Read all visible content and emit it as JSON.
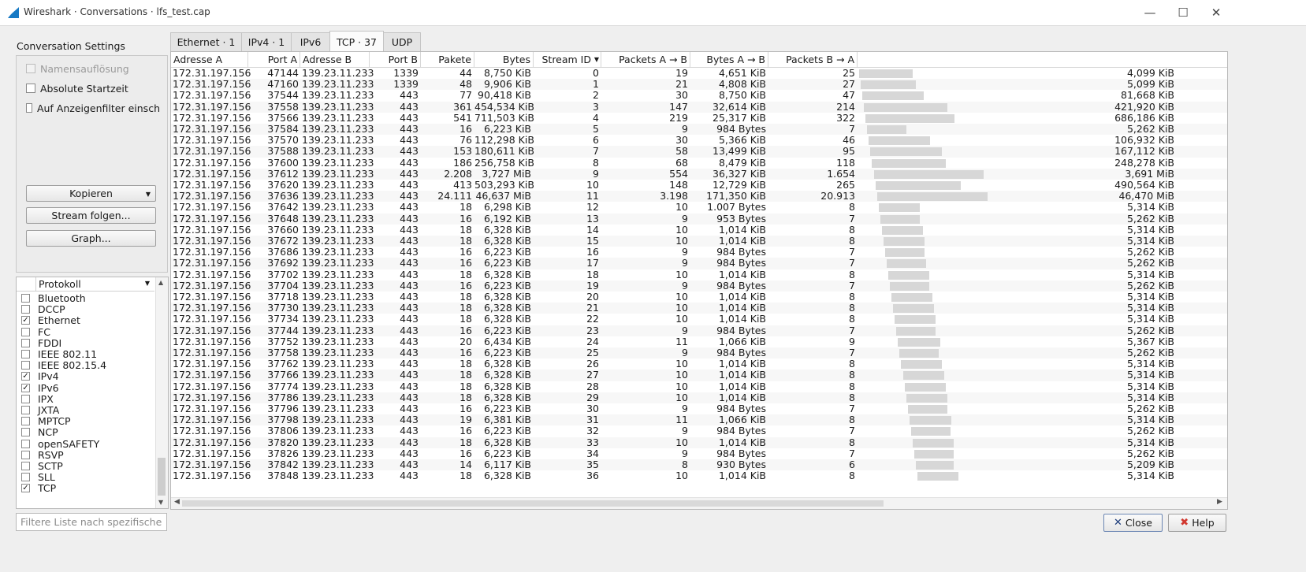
{
  "window": {
    "title": "Wireshark · Conversations · lfs_test.cap"
  },
  "settings": {
    "title": "Conversation Settings",
    "name_resolution": "Namensauflösung",
    "absolute_start": "Absolute Startzeit",
    "limit_filter": "Auf Anzeigenfilter einsch",
    "copy": "Kopieren",
    "follow_stream": "Stream folgen...",
    "graph": "Graph..."
  },
  "protocols": {
    "header": "Protokoll",
    "items": [
      {
        "label": "Bluetooth",
        "checked": false
      },
      {
        "label": "DCCP",
        "checked": false
      },
      {
        "label": "Ethernet",
        "checked": true
      },
      {
        "label": "FC",
        "checked": false
      },
      {
        "label": "FDDI",
        "checked": false
      },
      {
        "label": "IEEE 802.11",
        "checked": false
      },
      {
        "label": "IEEE 802.15.4",
        "checked": false
      },
      {
        "label": "IPv4",
        "checked": true
      },
      {
        "label": "IPv6",
        "checked": true
      },
      {
        "label": "IPX",
        "checked": false
      },
      {
        "label": "JXTA",
        "checked": false
      },
      {
        "label": "MPTCP",
        "checked": false
      },
      {
        "label": "NCP",
        "checked": false
      },
      {
        "label": "openSAFETY",
        "checked": false
      },
      {
        "label": "RSVP",
        "checked": false
      },
      {
        "label": "SCTP",
        "checked": false
      },
      {
        "label": "SLL",
        "checked": false
      },
      {
        "label": "TCP",
        "checked": true
      }
    ],
    "filter_placeholder": "Filtere Liste nach spezifische..."
  },
  "tabs": [
    "Ethernet · 1",
    "IPv4 · 1",
    "IPv6",
    "TCP · 37",
    "UDP"
  ],
  "active_tab": 3,
  "columns": [
    "Adresse A",
    "Port A",
    "Adresse B",
    "Port B",
    "Pakete",
    "Bytes",
    "Stream ID",
    "Packets A → B",
    "Bytes A → B",
    "Packets B → A"
  ],
  "rows": [
    [
      "172.31.197.156",
      "47144",
      "139.23.11.233",
      "1339",
      "44",
      "8,750 KiB",
      "0",
      "19",
      "4,651 KiB",
      "25",
      "4,099 KiB"
    ],
    [
      "172.31.197.156",
      "47160",
      "139.23.11.233",
      "1339",
      "48",
      "9,906 KiB",
      "1",
      "21",
      "4,808 KiB",
      "27",
      "5,099 KiB"
    ],
    [
      "172.31.197.156",
      "37544",
      "139.23.11.233",
      "443",
      "77",
      "90,418 KiB",
      "2",
      "30",
      "8,750 KiB",
      "47",
      "81,668 KiB"
    ],
    [
      "172.31.197.156",
      "37558",
      "139.23.11.233",
      "443",
      "361",
      "454,534 KiB",
      "3",
      "147",
      "32,614 KiB",
      "214",
      "421,920 KiB"
    ],
    [
      "172.31.197.156",
      "37566",
      "139.23.11.233",
      "443",
      "541",
      "711,503 KiB",
      "4",
      "219",
      "25,317 KiB",
      "322",
      "686,186 KiB"
    ],
    [
      "172.31.197.156",
      "37584",
      "139.23.11.233",
      "443",
      "16",
      "6,223 KiB",
      "5",
      "9",
      "984 Bytes",
      "7",
      "5,262 KiB"
    ],
    [
      "172.31.197.156",
      "37570",
      "139.23.11.233",
      "443",
      "76",
      "112,298 KiB",
      "6",
      "30",
      "5,366 KiB",
      "46",
      "106,932 KiB"
    ],
    [
      "172.31.197.156",
      "37588",
      "139.23.11.233",
      "443",
      "153",
      "180,611 KiB",
      "7",
      "58",
      "13,499 KiB",
      "95",
      "167,112 KiB"
    ],
    [
      "172.31.197.156",
      "37600",
      "139.23.11.233",
      "443",
      "186",
      "256,758 KiB",
      "8",
      "68",
      "8,479 KiB",
      "118",
      "248,278 KiB"
    ],
    [
      "172.31.197.156",
      "37612",
      "139.23.11.233",
      "443",
      "2.208",
      "3,727 MiB",
      "9",
      "554",
      "36,327 KiB",
      "1.654",
      "3,691 MiB"
    ],
    [
      "172.31.197.156",
      "37620",
      "139.23.11.233",
      "443",
      "413",
      "503,293 KiB",
      "10",
      "148",
      "12,729 KiB",
      "265",
      "490,564 KiB"
    ],
    [
      "172.31.197.156",
      "37636",
      "139.23.11.233",
      "443",
      "24.111",
      "46,637 MiB",
      "11",
      "3.198",
      "171,350 KiB",
      "20.913",
      "46,470 MiB"
    ],
    [
      "172.31.197.156",
      "37642",
      "139.23.11.233",
      "443",
      "18",
      "6,298 KiB",
      "12",
      "10",
      "1.007 Bytes",
      "8",
      "5,314 KiB"
    ],
    [
      "172.31.197.156",
      "37648",
      "139.23.11.233",
      "443",
      "16",
      "6,192 KiB",
      "13",
      "9",
      "953 Bytes",
      "7",
      "5,262 KiB"
    ],
    [
      "172.31.197.156",
      "37660",
      "139.23.11.233",
      "443",
      "18",
      "6,328 KiB",
      "14",
      "10",
      "1,014 KiB",
      "8",
      "5,314 KiB"
    ],
    [
      "172.31.197.156",
      "37672",
      "139.23.11.233",
      "443",
      "18",
      "6,328 KiB",
      "15",
      "10",
      "1,014 KiB",
      "8",
      "5,314 KiB"
    ],
    [
      "172.31.197.156",
      "37686",
      "139.23.11.233",
      "443",
      "16",
      "6,223 KiB",
      "16",
      "9",
      "984 Bytes",
      "7",
      "5,262 KiB"
    ],
    [
      "172.31.197.156",
      "37692",
      "139.23.11.233",
      "443",
      "16",
      "6,223 KiB",
      "17",
      "9",
      "984 Bytes",
      "7",
      "5,262 KiB"
    ],
    [
      "172.31.197.156",
      "37702",
      "139.23.11.233",
      "443",
      "18",
      "6,328 KiB",
      "18",
      "10",
      "1,014 KiB",
      "8",
      "5,314 KiB"
    ],
    [
      "172.31.197.156",
      "37704",
      "139.23.11.233",
      "443",
      "16",
      "6,223 KiB",
      "19",
      "9",
      "984 Bytes",
      "7",
      "5,262 KiB"
    ],
    [
      "172.31.197.156",
      "37718",
      "139.23.11.233",
      "443",
      "18",
      "6,328 KiB",
      "20",
      "10",
      "1,014 KiB",
      "8",
      "5,314 KiB"
    ],
    [
      "172.31.197.156",
      "37730",
      "139.23.11.233",
      "443",
      "18",
      "6,328 KiB",
      "21",
      "10",
      "1,014 KiB",
      "8",
      "5,314 KiB"
    ],
    [
      "172.31.197.156",
      "37734",
      "139.23.11.233",
      "443",
      "18",
      "6,328 KiB",
      "22",
      "10",
      "1,014 KiB",
      "8",
      "5,314 KiB"
    ],
    [
      "172.31.197.156",
      "37744",
      "139.23.11.233",
      "443",
      "16",
      "6,223 KiB",
      "23",
      "9",
      "984 Bytes",
      "7",
      "5,262 KiB"
    ],
    [
      "172.31.197.156",
      "37752",
      "139.23.11.233",
      "443",
      "20",
      "6,434 KiB",
      "24",
      "11",
      "1,066 KiB",
      "9",
      "5,367 KiB"
    ],
    [
      "172.31.197.156",
      "37758",
      "139.23.11.233",
      "443",
      "16",
      "6,223 KiB",
      "25",
      "9",
      "984 Bytes",
      "7",
      "5,262 KiB"
    ],
    [
      "172.31.197.156",
      "37762",
      "139.23.11.233",
      "443",
      "18",
      "6,328 KiB",
      "26",
      "10",
      "1,014 KiB",
      "8",
      "5,314 KiB"
    ],
    [
      "172.31.197.156",
      "37766",
      "139.23.11.233",
      "443",
      "18",
      "6,328 KiB",
      "27",
      "10",
      "1,014 KiB",
      "8",
      "5,314 KiB"
    ],
    [
      "172.31.197.156",
      "37774",
      "139.23.11.233",
      "443",
      "18",
      "6,328 KiB",
      "28",
      "10",
      "1,014 KiB",
      "8",
      "5,314 KiB"
    ],
    [
      "172.31.197.156",
      "37786",
      "139.23.11.233",
      "443",
      "18",
      "6,328 KiB",
      "29",
      "10",
      "1,014 KiB",
      "8",
      "5,314 KiB"
    ],
    [
      "172.31.197.156",
      "37796",
      "139.23.11.233",
      "443",
      "16",
      "6,223 KiB",
      "30",
      "9",
      "984 Bytes",
      "7",
      "5,262 KiB"
    ],
    [
      "172.31.197.156",
      "37798",
      "139.23.11.233",
      "443",
      "19",
      "6,381 KiB",
      "31",
      "11",
      "1,066 KiB",
      "8",
      "5,314 KiB"
    ],
    [
      "172.31.197.156",
      "37806",
      "139.23.11.233",
      "443",
      "16",
      "6,223 KiB",
      "32",
      "9",
      "984 Bytes",
      "7",
      "5,262 KiB"
    ],
    [
      "172.31.197.156",
      "37820",
      "139.23.11.233",
      "443",
      "18",
      "6,328 KiB",
      "33",
      "10",
      "1,014 KiB",
      "8",
      "5,314 KiB"
    ],
    [
      "172.31.197.156",
      "37826",
      "139.23.11.233",
      "443",
      "16",
      "6,223 KiB",
      "34",
      "9",
      "984 Bytes",
      "7",
      "5,262 KiB"
    ],
    [
      "172.31.197.156",
      "37842",
      "139.23.11.233",
      "443",
      "14",
      "6,117 KiB",
      "35",
      "8",
      "930 Bytes",
      "6",
      "5,209 KiB"
    ],
    [
      "172.31.197.156",
      "37848",
      "139.23.11.233",
      "443",
      "18",
      "6,328 KiB",
      "36",
      "10",
      "1,014 KiB",
      "8",
      "5,314 KiB"
    ]
  ],
  "buttons": {
    "close": "Close",
    "help": "Help"
  }
}
